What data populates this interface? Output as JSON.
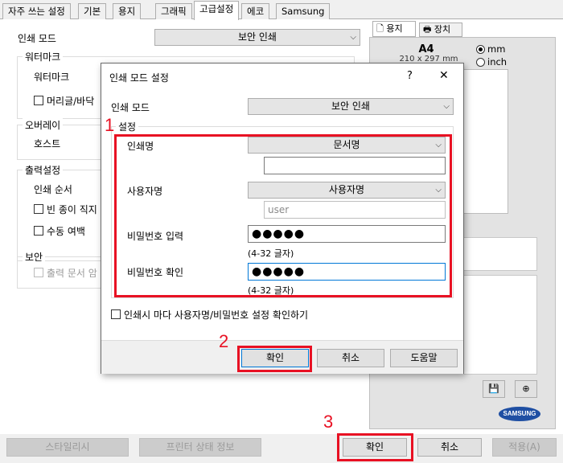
{
  "tabs": [
    "자주 쓰는 설정",
    "기본",
    "용지",
    "그래픽",
    "고급설정",
    "에코",
    "Samsung"
  ],
  "active_tab": "고급설정",
  "main": {
    "print_mode_label": "인쇄 모드",
    "print_mode_value": "보안 인쇄",
    "watermark_group": "워터마크",
    "watermark_label": "워터마크",
    "header_footer_label": "머리글/바닥",
    "overlay_group": "오버레이",
    "host_label": "호스트",
    "output_group": "출력설정",
    "print_order_label": "인쇄 순서",
    "blank_page_label": "빈 종이 직지",
    "manual_margin_label": "수동 여백",
    "security_group": "보안",
    "output_doc_label": "출력 문서 암"
  },
  "preview": {
    "tab_paper": "용지",
    "tab_device": "장치",
    "paper_size": "A4",
    "paper_dims": "210 x 297 mm",
    "unit_mm": "mm",
    "unit_inch": "inch",
    "brand": "SAMSUNG"
  },
  "bottom": {
    "style_button": "스타일리시",
    "printer_status_button": "프린터 상태 정보",
    "ok_button": "확인",
    "cancel_button": "취소",
    "apply_button": "적용(A)"
  },
  "dialog": {
    "title": "인쇄 모드 설정",
    "help_glyph": "?",
    "close_glyph": "✕",
    "print_mode_label": "인쇄 모드",
    "print_mode_value": "보안 인쇄",
    "settings_group": "설정",
    "job_name_label": "인쇄명",
    "job_name_value": "문서명",
    "job_name_field": "",
    "user_name_label": "사용자명",
    "user_name_value": "사용자명",
    "user_name_field": "user",
    "password_label": "비밀번호 입력",
    "password_value": "●●●●●",
    "password_hint": "(4-32 글자)",
    "confirm_label": "비밀번호 확인",
    "confirm_value": "●●●●●",
    "confirm_hint": "(4-32 글자)",
    "check_label": "인쇄시 마다 사용자명/비밀번호 설정 확인하기",
    "ok_button": "확인",
    "cancel_button": "취소",
    "help_button": "도움말"
  },
  "callouts": [
    "1",
    "2",
    "3"
  ],
  "colors": {
    "callout": "#e81123",
    "focus": "#0078d7"
  }
}
